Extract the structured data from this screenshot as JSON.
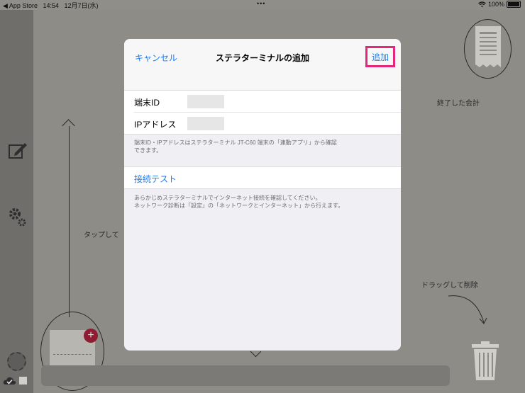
{
  "status_bar": {
    "back_app": "◀ App Store",
    "time": "14:54",
    "date": "12月7日(水)",
    "center_dots": "•••",
    "battery": "100%"
  },
  "background": {
    "receipt_label": "終了した会計",
    "tap_hint": "タップして",
    "drag_hint": "ドラッグして削除"
  },
  "modal": {
    "cancel_label": "キャンセル",
    "title": "ステラターミナルの追加",
    "add_label": "追加",
    "fields": [
      {
        "label": "端末ID",
        "value": ""
      },
      {
        "label": "IPアドレス",
        "value": ""
      }
    ],
    "fields_note_line1": "端末ID・IPアドレスはステラターミナル JT-C60 端末の「連動アプリ」から確認",
    "fields_note_line2": "できます。",
    "connection_test_label": "接続テスト",
    "test_note_line1": "あらかじめステラターミナルでインターネット接続を確認してください。",
    "test_note_line2": "ネットワーク診断は「設定」の「ネットワークとインターネット」から行えます。"
  },
  "colors": {
    "accent": "#1a7cf0",
    "highlight": "#e3287a"
  }
}
